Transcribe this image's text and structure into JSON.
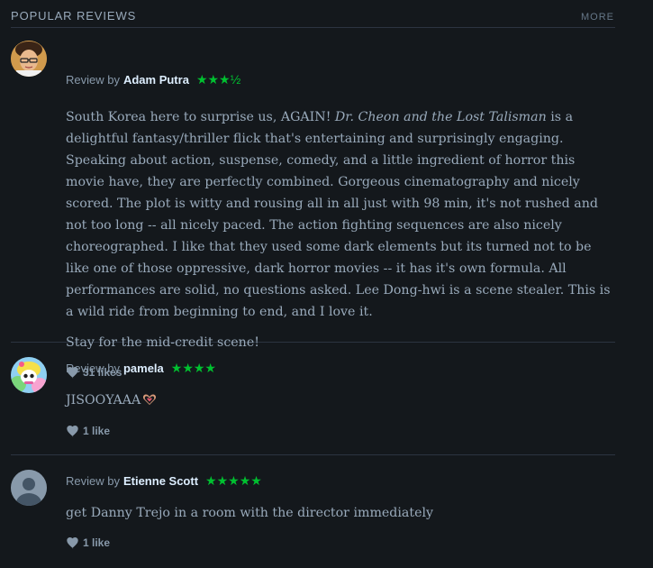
{
  "header": {
    "title": "Popular Reviews",
    "more_label": "More"
  },
  "reviews": [
    {
      "by_label": "Review by",
      "author": "Adam Putra",
      "rating_stars": "★★★½",
      "rating": 3.5,
      "paragraphs": [
        {
          "pre": "South Korea here to surprise us, AGAIN! ",
          "italic": "Dr. Cheon and the Lost Talisman",
          "post": " is a delightful fantasy/thriller flick that's entertaining and surprisingly engaging. Speaking about action, suspense, comedy, and a little ingredient of horror this movie have, they are perfectly combined. Gorgeous cinematography and nicely scored. The plot is witty and rousing all in all just with 98 min, it's not rushed and not too long -- all nicely paced. The action fighting sequences are also nicely choreographed. I like that they used some dark elements but its turned not to be like one of those oppressive, dark horror movies -- it has it's own formula. All performances are solid, no questions asked. Lee Dong-hwi is a scene stealer. This is a wild ride from beginning to end, and I love it."
        },
        {
          "text": "Stay for the mid-credit scene!"
        }
      ],
      "likes": "31 likes"
    },
    {
      "by_label": "Review by",
      "author": "pamela",
      "rating_stars": "★★★★",
      "rating": 4,
      "text": "JISOOYAAA",
      "emoji": "heart-hands-icon",
      "likes": "1 like"
    },
    {
      "by_label": "Review by",
      "author": "Etienne Scott",
      "rating_stars": "★★★★★",
      "rating": 5,
      "text": "get Danny Trejo in a room with the director immediately",
      "likes": "1 like"
    }
  ],
  "colors": {
    "background": "#14181c",
    "star_green": "#00c030",
    "text": "#99aabb",
    "author": "#ddeeff",
    "divider": "#2c3440"
  }
}
